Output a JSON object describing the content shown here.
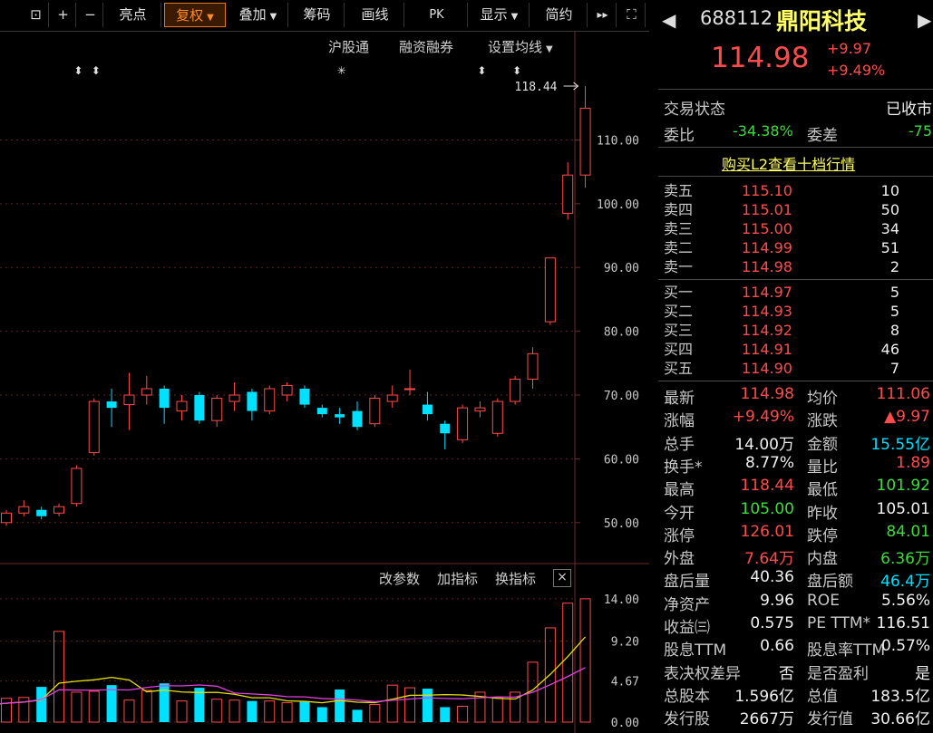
{
  "toolbar": {
    "buttons": [
      {
        "label": "⊡",
        "icon": "unlock-icon"
      },
      {
        "label": "+",
        "icon": "zoom-in-icon"
      },
      {
        "label": "−",
        "icon": "zoom-out-icon"
      },
      {
        "label": "亮点"
      },
      {
        "label": "复权"
      },
      {
        "label": "叠加"
      },
      {
        "label": "筹码"
      },
      {
        "label": "画线"
      },
      {
        "label": "PK"
      },
      {
        "label": "显示"
      },
      {
        "label": "简约"
      },
      {
        "label": "▸▸",
        "icon": "fast-forward-icon"
      },
      {
        "label": "⛶",
        "icon": "fullscreen-icon"
      }
    ]
  },
  "links": {
    "hgt": "沪股通",
    "rzrq": "融资融券",
    "ma": "设置均线"
  },
  "indicator_links": {
    "params": "改参数",
    "add": "加指标",
    "switch": "换指标",
    "close": "×"
  },
  "annotations": {
    "high": "118.44"
  },
  "colors": {
    "up": "#ff4b4b",
    "down": "#00e0ff",
    "ma_yellow": "#e8e000",
    "ma_magenta": "#e040e0",
    "grid": "#5a2020"
  },
  "chart_data": [
    {
      "type": "candlestick",
      "ylim": [
        45,
        122
      ],
      "yticks": [
        "110.00",
        "100.00",
        "90.00",
        "80.00",
        "70.00",
        "60.00",
        "50.00"
      ],
      "candles": [
        [
          50.0,
          51.5,
          49.5,
          52.0
        ],
        [
          51.5,
          52.5,
          51.0,
          53.5
        ],
        [
          52.0,
          51.0,
          50.5,
          52.5
        ],
        [
          51.5,
          52.5,
          51.0,
          53.0
        ],
        [
          53.0,
          58.5,
          52.5,
          59.0
        ],
        [
          61.0,
          69.0,
          60.5,
          69.5
        ],
        [
          69.0,
          68.0,
          65.0,
          71.0
        ],
        [
          68.5,
          70.0,
          64.5,
          73.5
        ],
        [
          70.0,
          71.0,
          68.5,
          73.0
        ],
        [
          71.0,
          68.0,
          65.5,
          71.5
        ],
        [
          67.5,
          69.0,
          66.0,
          70.0
        ],
        [
          70.0,
          66.0,
          65.5,
          70.5
        ],
        [
          66.0,
          69.5,
          65.0,
          70.0
        ],
        [
          69.0,
          70.0,
          67.5,
          72.0
        ],
        [
          70.5,
          67.5,
          66.0,
          71.0
        ],
        [
          67.5,
          71.0,
          67.0,
          71.5
        ],
        [
          70.0,
          71.5,
          69.0,
          72.0
        ],
        [
          71.0,
          68.5,
          68.0,
          71.5
        ],
        [
          68.0,
          67.0,
          66.5,
          68.5
        ],
        [
          67.0,
          66.5,
          65.5,
          68.0
        ],
        [
          67.5,
          65.0,
          64.5,
          69.0
        ],
        [
          65.5,
          69.5,
          65.0,
          70.0
        ],
        [
          69.0,
          70.0,
          68.0,
          71.5
        ],
        [
          71.0,
          71.0,
          70.0,
          74.0
        ],
        [
          68.5,
          67.0,
          66.0,
          70.5
        ],
        [
          65.5,
          64.0,
          61.5,
          66.0
        ],
        [
          63.0,
          68.0,
          62.5,
          68.5
        ],
        [
          67.5,
          68.0,
          66.5,
          69.0
        ],
        [
          64.0,
          69.0,
          63.5,
          69.5
        ],
        [
          69.0,
          72.5,
          68.5,
          73.0
        ],
        [
          72.5,
          76.5,
          71.0,
          77.5
        ],
        [
          81.5,
          91.5,
          81.0,
          91.5
        ],
        [
          98.5,
          104.5,
          97.5,
          106.5
        ],
        [
          104.5,
          114.98,
          102.5,
          118.44
        ]
      ]
    },
    {
      "type": "bar",
      "ylim": [
        0,
        14.5
      ],
      "yticks": [
        "14.00",
        "9.20",
        "4.67",
        "0.00"
      ],
      "values": [
        2.8,
        0.8,
        2.3,
        2.7,
        2.8,
        4.0,
        10.3,
        3.4,
        3.5,
        4.2,
        2.5,
        3.6,
        4.4,
        2.4,
        3.9,
        2.6,
        2.5,
        2.4,
        2.4,
        2.2,
        2.3,
        1.7,
        3.7,
        1.4,
        2.0,
        4.2,
        3.9,
        3.8,
        1.7,
        1.8,
        3.4,
        2.8,
        3.4,
        6.8,
        10.7,
        13.5,
        14.0
      ]
    }
  ],
  "stock": {
    "code": "688112",
    "name": "鼎阳科技",
    "price": "114.98",
    "change": "+9.97",
    "change_pct": "+9.49%",
    "trade_status_label": "交易状态",
    "trade_status": "已收市",
    "weibi_label": "委比",
    "weibi": "-34.38%",
    "weicha_label": "委差",
    "weicha": "-75",
    "l2_link": "购买L2查看十档行情"
  },
  "asks": [
    {
      "label": "卖五",
      "price": "115.10",
      "vol": "10"
    },
    {
      "label": "卖四",
      "price": "115.01",
      "vol": "50"
    },
    {
      "label": "卖三",
      "price": "115.00",
      "vol": "34"
    },
    {
      "label": "卖二",
      "price": "114.99",
      "vol": "51"
    },
    {
      "label": "卖一",
      "price": "114.98",
      "vol": "2"
    }
  ],
  "bids": [
    {
      "label": "买一",
      "price": "114.97",
      "vol": "5"
    },
    {
      "label": "买二",
      "price": "114.93",
      "vol": "5"
    },
    {
      "label": "买三",
      "price": "114.92",
      "vol": "8"
    },
    {
      "label": "买四",
      "price": "114.91",
      "vol": "46"
    },
    {
      "label": "买五",
      "price": "114.90",
      "vol": "7"
    }
  ],
  "stats": [
    {
      "l1": "最新",
      "v1": "114.98",
      "c1": "red",
      "l2": "均价",
      "v2": "111.06",
      "c2": "red"
    },
    {
      "l1": "涨幅",
      "v1": "+9.49%",
      "c1": "red",
      "l2": "涨跌",
      "v2": "▲9.97",
      "c2": "red"
    },
    {
      "l1": "总手",
      "v1": "14.00万",
      "c1": "white",
      "l2": "金额",
      "v2": "15.55亿",
      "c2": "cyan"
    },
    {
      "l1": "换手*",
      "v1": "8.77%",
      "c1": "white",
      "l2": "量比",
      "v2": "1.89",
      "c2": "red"
    },
    {
      "l1": "最高",
      "v1": "118.44",
      "c1": "red",
      "l2": "最低",
      "v2": "101.92",
      "c2": "green"
    },
    {
      "l1": "今开",
      "v1": "105.00",
      "c1": "green",
      "l2": "昨收",
      "v2": "105.01",
      "c2": "white"
    },
    {
      "l1": "涨停",
      "v1": "126.01",
      "c1": "red",
      "l2": "跌停",
      "v2": "84.01",
      "c2": "green"
    },
    {
      "l1": "外盘",
      "v1": "7.64万",
      "c1": "red",
      "l2": "内盘",
      "v2": "6.36万",
      "c2": "green"
    },
    {
      "l1": "盘后量",
      "v1": "40.36",
      "c1": "white",
      "l2": "盘后额",
      "v2": "46.4万",
      "c2": "cyan"
    },
    {
      "l1": "净资产",
      "v1": "9.96",
      "c1": "white",
      "l2": "ROE",
      "v2": "5.56%",
      "c2": "white"
    },
    {
      "l1": "收益㈢",
      "v1": "0.575",
      "c1": "white",
      "l2": "PE TTM*",
      "v2": "116.51",
      "c2": "white"
    },
    {
      "l1": "股息TTM",
      "v1": "0.66",
      "c1": "white",
      "l2": "股息率TTM",
      "v2": "0.57%",
      "c2": "white"
    },
    {
      "l1": "表决权差异",
      "v1": "否",
      "c1": "white",
      "l2": "是否盈利",
      "v2": "是",
      "c2": "white"
    },
    {
      "l1": "总股本",
      "v1": "1.596亿",
      "c1": "white",
      "l2": "总值",
      "v2": "183.5亿",
      "c2": "white"
    },
    {
      "l1": "发行股",
      "v1": "2667万",
      "c1": "white",
      "l2": "发行值",
      "v2": "30.66亿",
      "c2": "white"
    }
  ]
}
